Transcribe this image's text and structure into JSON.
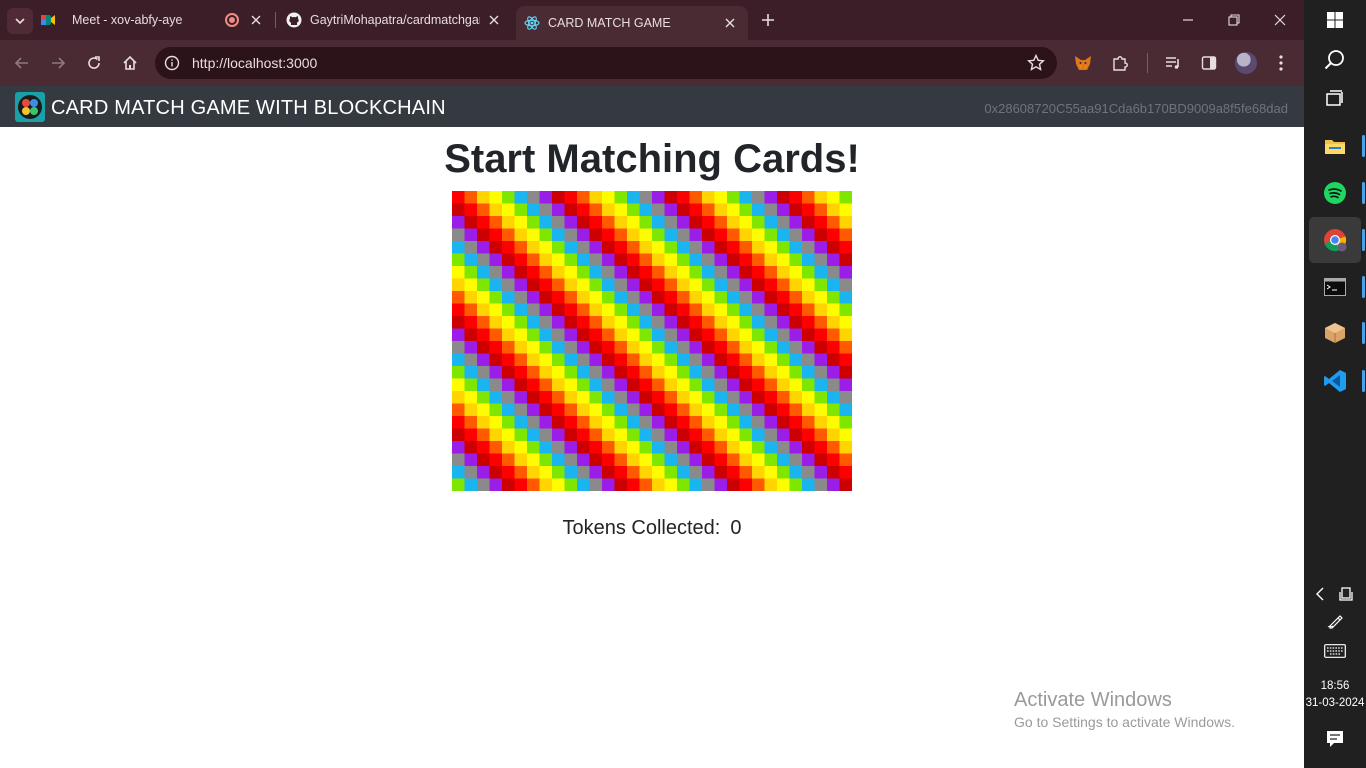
{
  "browser": {
    "tabs": [
      {
        "title": "Meet - xov-abfy-aye",
        "favicon": "google-meet-icon",
        "recording": true,
        "active": false
      },
      {
        "title": "GaytriMohapatra/cardmatchgam",
        "favicon": "github-icon",
        "active": false
      },
      {
        "title": "CARD MATCH GAME",
        "favicon": "react-icon",
        "active": true
      }
    ],
    "address": "http://localhost:3000"
  },
  "app": {
    "title": "CARD MATCH GAME WITH BLOCKCHAIN",
    "account": "0x28608720C55aa91Cda6b170BD9009a8f5fe68dad"
  },
  "page": {
    "heading": "Start Matching Cards!",
    "tokens_label": "Tokens Collected:",
    "tokens_value": "0"
  },
  "watermark": {
    "title": "Activate Windows",
    "subtitle": "Go to Settings to activate Windows."
  },
  "taskbar": {
    "time": "18:56",
    "date": "31-03-2024",
    "apps": [
      "start-icon",
      "search-icon",
      "task-view-icon",
      "file-explorer-icon",
      "spotify-icon",
      "chrome-icon",
      "terminal-icon",
      "package-icon",
      "vscode-icon"
    ]
  },
  "colors": {
    "tabstrip": "#3b1e27",
    "toolbar": "#4a2a33",
    "appbar": "#343a40",
    "board_palette": [
      "#ff0000",
      "#ff5a00",
      "#ffd400",
      "#fdfd00",
      "#7fe600",
      "#1ab4f0",
      "#8a8a8a",
      "#9b1de8",
      "#cc0000"
    ]
  }
}
